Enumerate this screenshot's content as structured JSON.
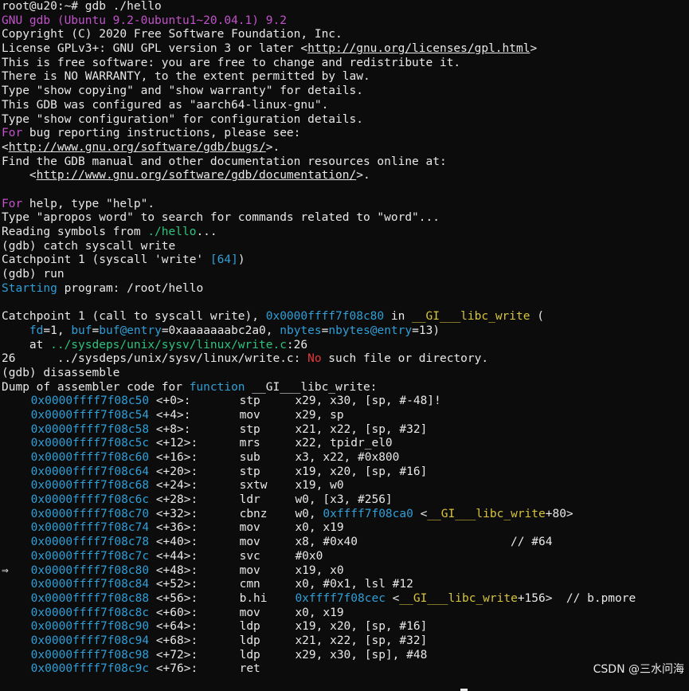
{
  "lines": [
    {
      "segs": [
        {
          "t": "root@u20:~# gdb ./hello",
          "c": ""
        }
      ]
    },
    {
      "segs": [
        {
          "t": "GNU gdb (Ubuntu 9.2-0ubuntu1~20.04.1) 9.2",
          "c": "c-magenta"
        }
      ]
    },
    {
      "segs": [
        {
          "t": "Copyright (C) 2020 Free Software Foundation, Inc.",
          "c": ""
        }
      ]
    },
    {
      "segs": [
        {
          "t": "License GPLv3+: GNU GPL version 3 or later <",
          "c": ""
        },
        {
          "t": "http://gnu.org/licenses/gpl.html",
          "c": "u"
        },
        {
          "t": ">",
          "c": ""
        }
      ]
    },
    {
      "segs": [
        {
          "t": "This is free software: you are free to change and redistribute it.",
          "c": ""
        }
      ]
    },
    {
      "segs": [
        {
          "t": "There is NO WARRANTY, to the extent permitted by law.",
          "c": ""
        }
      ]
    },
    {
      "segs": [
        {
          "t": "Type \"show copying\" and \"show warranty\" for details.",
          "c": ""
        }
      ]
    },
    {
      "segs": [
        {
          "t": "This GDB was configured as \"aarch64-linux-gnu\".",
          "c": ""
        }
      ]
    },
    {
      "segs": [
        {
          "t": "Type \"show configuration\" for configuration details.",
          "c": ""
        }
      ]
    },
    {
      "segs": [
        {
          "t": "For",
          "c": "c-magenta"
        },
        {
          "t": " bug reporting instructions, please see:",
          "c": ""
        }
      ]
    },
    {
      "segs": [
        {
          "t": "<",
          "c": ""
        },
        {
          "t": "http://www.gnu.org/software/gdb/bugs/",
          "c": "u"
        },
        {
          "t": ">.",
          "c": ""
        }
      ]
    },
    {
      "segs": [
        {
          "t": "Find the GDB manual and other documentation resources online at:",
          "c": ""
        }
      ]
    },
    {
      "segs": [
        {
          "t": "    <",
          "c": ""
        },
        {
          "t": "http://www.gnu.org/software/gdb/documentation/",
          "c": "u"
        },
        {
          "t": ">.",
          "c": ""
        }
      ]
    },
    {
      "segs": [
        {
          "t": "",
          "c": ""
        }
      ]
    },
    {
      "segs": [
        {
          "t": "For",
          "c": "c-magenta"
        },
        {
          "t": " help, type \"help\".",
          "c": ""
        }
      ]
    },
    {
      "segs": [
        {
          "t": "Type \"apropos word\" to search for commands related to \"word\"...",
          "c": ""
        }
      ]
    },
    {
      "segs": [
        {
          "t": "Reading symbols from ",
          "c": ""
        },
        {
          "t": "./hello",
          "c": "c-green"
        },
        {
          "t": "...",
          "c": ""
        }
      ]
    },
    {
      "segs": [
        {
          "t": "(gdb) catch syscall write",
          "c": ""
        }
      ]
    },
    {
      "segs": [
        {
          "t": "Catchpoint 1 (syscall 'write' ",
          "c": ""
        },
        {
          "t": "[64]",
          "c": "c-cyan"
        },
        {
          "t": ")",
          "c": ""
        }
      ]
    },
    {
      "segs": [
        {
          "t": "(gdb) run",
          "c": ""
        }
      ]
    },
    {
      "segs": [
        {
          "t": "Starting",
          "c": "c-cyan"
        },
        {
          "t": " program: /root/hello",
          "c": ""
        }
      ]
    },
    {
      "segs": [
        {
          "t": "",
          "c": ""
        }
      ]
    },
    {
      "segs": [
        {
          "t": "Catchpoint 1 (call to syscall write), ",
          "c": ""
        },
        {
          "t": "0x0000ffff7f08c80",
          "c": "c-cyan"
        },
        {
          "t": " in ",
          "c": ""
        },
        {
          "t": "__GI___libc_write",
          "c": "c-yellow"
        },
        {
          "t": " (",
          "c": ""
        }
      ]
    },
    {
      "segs": [
        {
          "t": "    ",
          "c": ""
        },
        {
          "t": "fd",
          "c": "c-cyan"
        },
        {
          "t": "=1, ",
          "c": ""
        },
        {
          "t": "buf",
          "c": "c-cyan"
        },
        {
          "t": "=",
          "c": ""
        },
        {
          "t": "buf@entry",
          "c": "c-cyan"
        },
        {
          "t": "=0xaaaaaaabc2a0, ",
          "c": ""
        },
        {
          "t": "nbytes",
          "c": "c-cyan"
        },
        {
          "t": "=",
          "c": ""
        },
        {
          "t": "nbytes@entry",
          "c": "c-cyan"
        },
        {
          "t": "=13)",
          "c": ""
        }
      ]
    },
    {
      "segs": [
        {
          "t": "    at ",
          "c": ""
        },
        {
          "t": "../sysdeps/unix/sysv/linux/write.c",
          "c": "c-green"
        },
        {
          "t": ":26",
          "c": ""
        }
      ]
    },
    {
      "segs": [
        {
          "t": "26      ../sysdeps/unix/sysv/linux/write.c: ",
          "c": ""
        },
        {
          "t": "No",
          "c": "c-red"
        },
        {
          "t": " such file or directory.",
          "c": ""
        }
      ]
    },
    {
      "segs": [
        {
          "t": "(gdb) disassemble",
          "c": ""
        }
      ]
    },
    {
      "segs": [
        {
          "t": "Dump of assembler code for ",
          "c": ""
        },
        {
          "t": "function",
          "c": "c-cyan"
        },
        {
          "t": " __GI___libc_write:",
          "c": ""
        }
      ]
    }
  ],
  "asm": [
    {
      "arrow": "",
      "addr": "0x0000ffff7f08c50",
      "off": "<+0>:",
      "op": "stp",
      "args": [
        {
          "t": "x29, x30, [sp, #-48]!",
          "c": ""
        }
      ]
    },
    {
      "arrow": "",
      "addr": "0x0000ffff7f08c54",
      "off": "<+4>:",
      "op": "mov",
      "args": [
        {
          "t": "x29, sp",
          "c": ""
        }
      ]
    },
    {
      "arrow": "",
      "addr": "0x0000ffff7f08c58",
      "off": "<+8>:",
      "op": "stp",
      "args": [
        {
          "t": "x21, x22, [sp, #32]",
          "c": ""
        }
      ]
    },
    {
      "arrow": "",
      "addr": "0x0000ffff7f08c5c",
      "off": "<+12>:",
      "op": "mrs",
      "args": [
        {
          "t": "x22, tpidr_el0",
          "c": ""
        }
      ]
    },
    {
      "arrow": "",
      "addr": "0x0000ffff7f08c60",
      "off": "<+16>:",
      "op": "sub",
      "args": [
        {
          "t": "x3, x22, #0x800",
          "c": ""
        }
      ]
    },
    {
      "arrow": "",
      "addr": "0x0000ffff7f08c64",
      "off": "<+20>:",
      "op": "stp",
      "args": [
        {
          "t": "x19, x20, [sp, #16]",
          "c": ""
        }
      ]
    },
    {
      "arrow": "",
      "addr": "0x0000ffff7f08c68",
      "off": "<+24>:",
      "op": "sxtw",
      "args": [
        {
          "t": "x19, w0",
          "c": ""
        }
      ]
    },
    {
      "arrow": "",
      "addr": "0x0000ffff7f08c6c",
      "off": "<+28>:",
      "op": "ldr",
      "args": [
        {
          "t": "w0, [x3, #256]",
          "c": ""
        }
      ]
    },
    {
      "arrow": "",
      "addr": "0x0000ffff7f08c70",
      "off": "<+32>:",
      "op": "cbnz",
      "args": [
        {
          "t": "w0, ",
          "c": ""
        },
        {
          "t": "0xffff7f08ca0",
          "c": "c-cyan"
        },
        {
          "t": " <",
          "c": ""
        },
        {
          "t": "__GI___libc_write",
          "c": "c-yellow"
        },
        {
          "t": "+80>",
          "c": ""
        }
      ]
    },
    {
      "arrow": "",
      "addr": "0x0000ffff7f08c74",
      "off": "<+36>:",
      "op": "mov",
      "args": [
        {
          "t": "x0, x19",
          "c": ""
        }
      ]
    },
    {
      "arrow": "",
      "addr": "0x0000ffff7f08c78",
      "off": "<+40>:",
      "op": "mov",
      "args": [
        {
          "t": "x8, #0x40                      // #64",
          "c": ""
        }
      ]
    },
    {
      "arrow": "",
      "addr": "0x0000ffff7f08c7c",
      "off": "<+44>:",
      "op": "svc",
      "args": [
        {
          "t": "#0x0",
          "c": ""
        }
      ]
    },
    {
      "arrow": "⇒",
      "addr": "0x0000ffff7f08c80",
      "off": "<+48>:",
      "op": "mov",
      "args": [
        {
          "t": "x19, x0",
          "c": ""
        }
      ]
    },
    {
      "arrow": "",
      "addr": "0x0000ffff7f08c84",
      "off": "<+52>:",
      "op": "cmn",
      "args": [
        {
          "t": "x0, #0x1, lsl #12",
          "c": ""
        }
      ]
    },
    {
      "arrow": "",
      "addr": "0x0000ffff7f08c88",
      "off": "<+56>:",
      "op": "b.hi",
      "args": [
        {
          "t": "0xffff7f08cec",
          "c": "c-cyan"
        },
        {
          "t": " <",
          "c": ""
        },
        {
          "t": "__GI___libc_write",
          "c": "c-yellow"
        },
        {
          "t": "+156>  // b.pmore",
          "c": ""
        }
      ]
    },
    {
      "arrow": "",
      "addr": "0x0000ffff7f08c8c",
      "off": "<+60>:",
      "op": "mov",
      "args": [
        {
          "t": "x0, x19",
          "c": ""
        }
      ]
    },
    {
      "arrow": "",
      "addr": "0x0000ffff7f08c90",
      "off": "<+64>:",
      "op": "ldp",
      "args": [
        {
          "t": "x19, x20, [sp, #16]",
          "c": ""
        }
      ]
    },
    {
      "arrow": "",
      "addr": "0x0000ffff7f08c94",
      "off": "<+68>:",
      "op": "ldp",
      "args": [
        {
          "t": "x21, x22, [sp, #32]",
          "c": ""
        }
      ]
    },
    {
      "arrow": "",
      "addr": "0x0000ffff7f08c98",
      "off": "<+72>:",
      "op": "ldp",
      "args": [
        {
          "t": "x29, x30, [sp], #48",
          "c": ""
        }
      ]
    },
    {
      "arrow": "",
      "addr": "0x0000ffff7f08c9c",
      "off": "<+76>:",
      "op": "ret",
      "args": []
    }
  ],
  "watermark": "CSDN @三水问海"
}
